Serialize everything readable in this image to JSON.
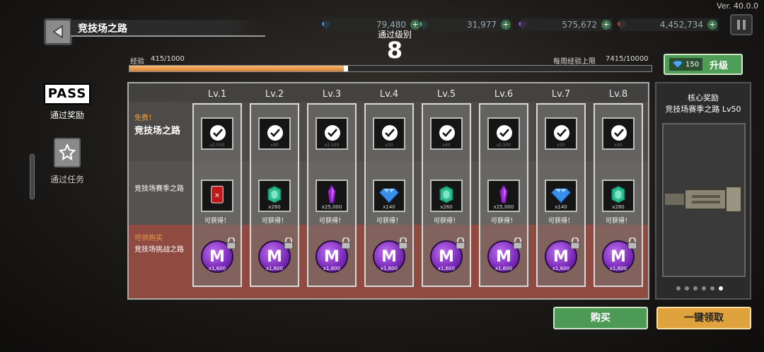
{
  "header": {
    "title": "竞技场之路",
    "version": "Ver. 40.0.0",
    "level_label": "通过级别",
    "level": "8"
  },
  "resources": [
    {
      "name": "gem",
      "value": "79,480",
      "color": "#3a8fe0",
      "icon": "blue-gem-icon"
    },
    {
      "name": "green-coin",
      "value": "31,977",
      "color": "#3ab89a",
      "icon": "green-coin-icon"
    },
    {
      "name": "purple-crystal",
      "value": "575,672",
      "color": "#a040d0",
      "icon": "purple-crystal-icon"
    },
    {
      "name": "gold",
      "value": "4,452,734",
      "color": "#c04040",
      "icon": "red-orb-icon"
    }
  ],
  "exp": {
    "label": "经验",
    "value": "415/1000",
    "fraction": 0.415,
    "weekly_label": "每周经验上限",
    "weekly_value": "7415/10000"
  },
  "upgrade": {
    "cost": "150",
    "label": "升级"
  },
  "sidebar": {
    "pass_badge": "PASS",
    "pass_label": "通过奖励",
    "task_label": "通过任务"
  },
  "rows": {
    "free_tag": "免费！",
    "free_title": "竞技场之路",
    "season_title": "竞技场赛季之路",
    "buy_tag": "可供购买",
    "buy_title": "竞技场挑战之路"
  },
  "levels": [
    {
      "lv": "Lv.1",
      "free_qty": "x2,500",
      "season_qty": "",
      "season_item": "red-card",
      "season_note": "可获得！",
      "coin_qty": "x1,600"
    },
    {
      "lv": "Lv.2",
      "free_qty": "x40",
      "season_qty": "x260",
      "season_item": "green-coin",
      "season_note": "可获得！",
      "coin_qty": "x1,600"
    },
    {
      "lv": "Lv.3",
      "free_qty": "x2,500",
      "season_qty": "x25,000",
      "season_item": "purple-crystal",
      "season_note": "可获得！",
      "coin_qty": "x1,600"
    },
    {
      "lv": "Lv.4",
      "free_qty": "x20",
      "season_qty": "x140",
      "season_item": "blue-gem",
      "season_note": "可获得！",
      "coin_qty": "x1,600"
    },
    {
      "lv": "Lv.5",
      "free_qty": "x40",
      "season_qty": "x260",
      "season_item": "green-coin",
      "season_note": "可获得！",
      "coin_qty": "x1,600"
    },
    {
      "lv": "Lv.6",
      "free_qty": "x2,500",
      "season_qty": "x25,000",
      "season_item": "purple-crystal",
      "season_note": "可获得！",
      "coin_qty": "x1,600"
    },
    {
      "lv": "Lv.7",
      "free_qty": "x20",
      "season_qty": "x140",
      "season_item": "blue-gem",
      "season_note": "可获得！",
      "coin_qty": "x1,600"
    },
    {
      "lv": "Lv.8",
      "free_qty": "x40",
      "season_qty": "x280",
      "season_item": "green-coin",
      "season_note": "可获得！",
      "coin_qty": "x1,600"
    }
  ],
  "preview": {
    "title": "核心奖励",
    "subtitle": "竞技场赛季之路 Lv50",
    "pages": 6,
    "current_page": 6
  },
  "buttons": {
    "buy": "购买",
    "claim_all": "一键领取"
  }
}
